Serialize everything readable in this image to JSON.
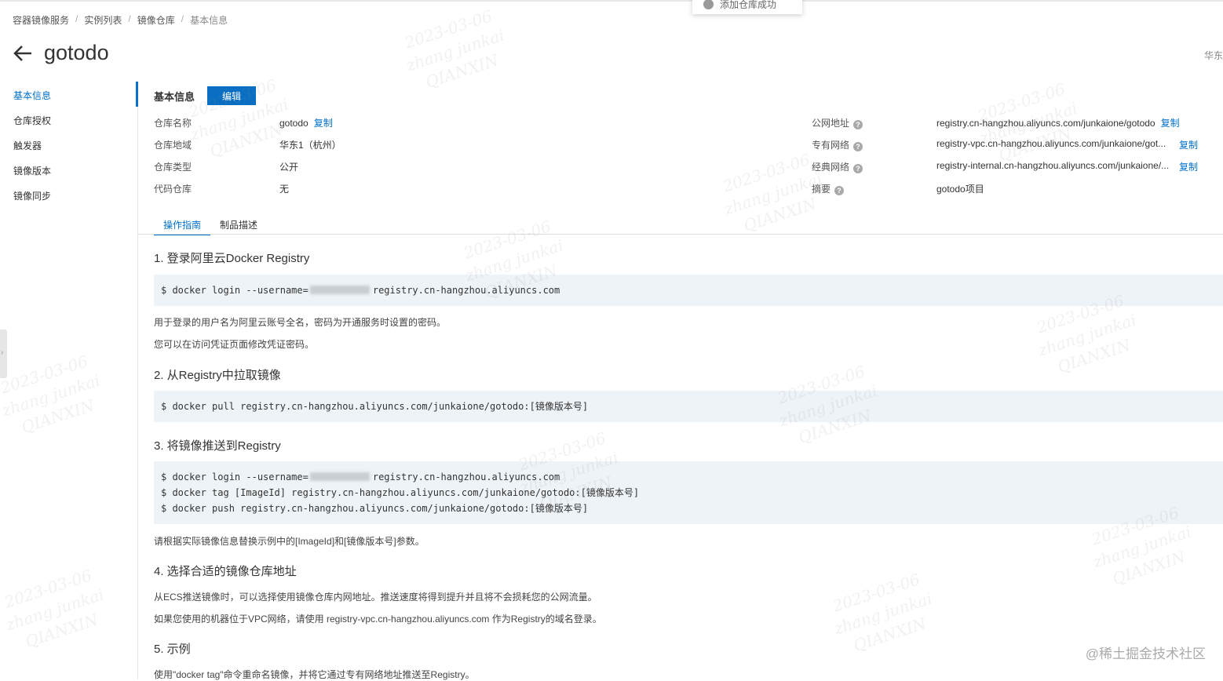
{
  "toast": {
    "text": "添加仓库成功"
  },
  "breadcrumb": [
    "容器镜像服务",
    "实例列表",
    "镜像仓库",
    "基本信息"
  ],
  "page": {
    "title": "gotodo",
    "region": "华东"
  },
  "sidebar": {
    "items": [
      "基本信息",
      "仓库授权",
      "触发器",
      "镜像版本",
      "镜像同步"
    ]
  },
  "basic": {
    "title": "基本信息",
    "edit_label": "编辑",
    "copy_label": "复制",
    "left": [
      {
        "label": "仓库名称",
        "value": "gotodo"
      },
      {
        "label": "仓库地域",
        "value": "华东1（杭州）"
      },
      {
        "label": "仓库类型",
        "value": "公开"
      },
      {
        "label": "代码仓库",
        "value": "无"
      }
    ],
    "right": [
      {
        "label": "公网地址",
        "value": "registry.cn-hangzhou.aliyuncs.com/junkaione/gotodo"
      },
      {
        "label": "专有网络",
        "value": "registry-vpc.cn-hangzhou.aliyuncs.com/junkaione/got..."
      },
      {
        "label": "经典网络",
        "value": "registry-internal.cn-hangzhou.aliyuncs.com/junkaione/..."
      },
      {
        "label": "摘要",
        "value": "gotodo项目"
      }
    ]
  },
  "tabs": [
    "操作指南",
    "制品描述"
  ],
  "guide": {
    "s1": {
      "title": "1. 登录阿里云Docker Registry",
      "code_prefix": "$ docker login --username=",
      "code_suffix": "registry.cn-hangzhou.aliyuncs.com",
      "p1": "用于登录的用户名为阿里云账号全名，密码为开通服务时设置的密码。",
      "p2": "您可以在访问凭证页面修改凭证密码。"
    },
    "s2": {
      "title": "2. 从Registry中拉取镜像",
      "code": "$ docker pull registry.cn-hangzhou.aliyuncs.com/junkaione/gotodo:[镜像版本号]"
    },
    "s3": {
      "title": "3. 将镜像推送到Registry",
      "code_login_prefix": "$ docker login --username=",
      "code_login_suffix": "registry.cn-hangzhou.aliyuncs.com",
      "code_tag": "$ docker tag [ImageId] registry.cn-hangzhou.aliyuncs.com/junkaione/gotodo:[镜像版本号]",
      "code_push": "$ docker push registry.cn-hangzhou.aliyuncs.com/junkaione/gotodo:[镜像版本号]",
      "p1": "请根据实际镜像信息替换示例中的[ImageId]和[镜像版本号]参数。"
    },
    "s4": {
      "title": "4. 选择合适的镜像仓库地址",
      "p1": "从ECS推送镜像时，可以选择使用镜像仓库内网地址。推送速度将得到提升并且将不会损耗您的公网流量。",
      "p2": "如果您使用的机器位于VPC网络，请使用 registry-vpc.cn-hangzhou.aliyuncs.com 作为Registry的域名登录。"
    },
    "s5": {
      "title": "5. 示例",
      "p1": "使用\"docker tag\"命令重命名镜像，并将它通过专有网络地址推送至Registry。"
    }
  },
  "watermark": {
    "line1": "2023-03-06",
    "line2": "zhang junkai",
    "line3": "QIANXIN"
  },
  "footer": {
    "mark": "@稀土掘金技术社区"
  },
  "colors": {
    "accent": "#0070cc",
    "button": "#0a6fc2",
    "code_bg": "#eef3f7"
  }
}
